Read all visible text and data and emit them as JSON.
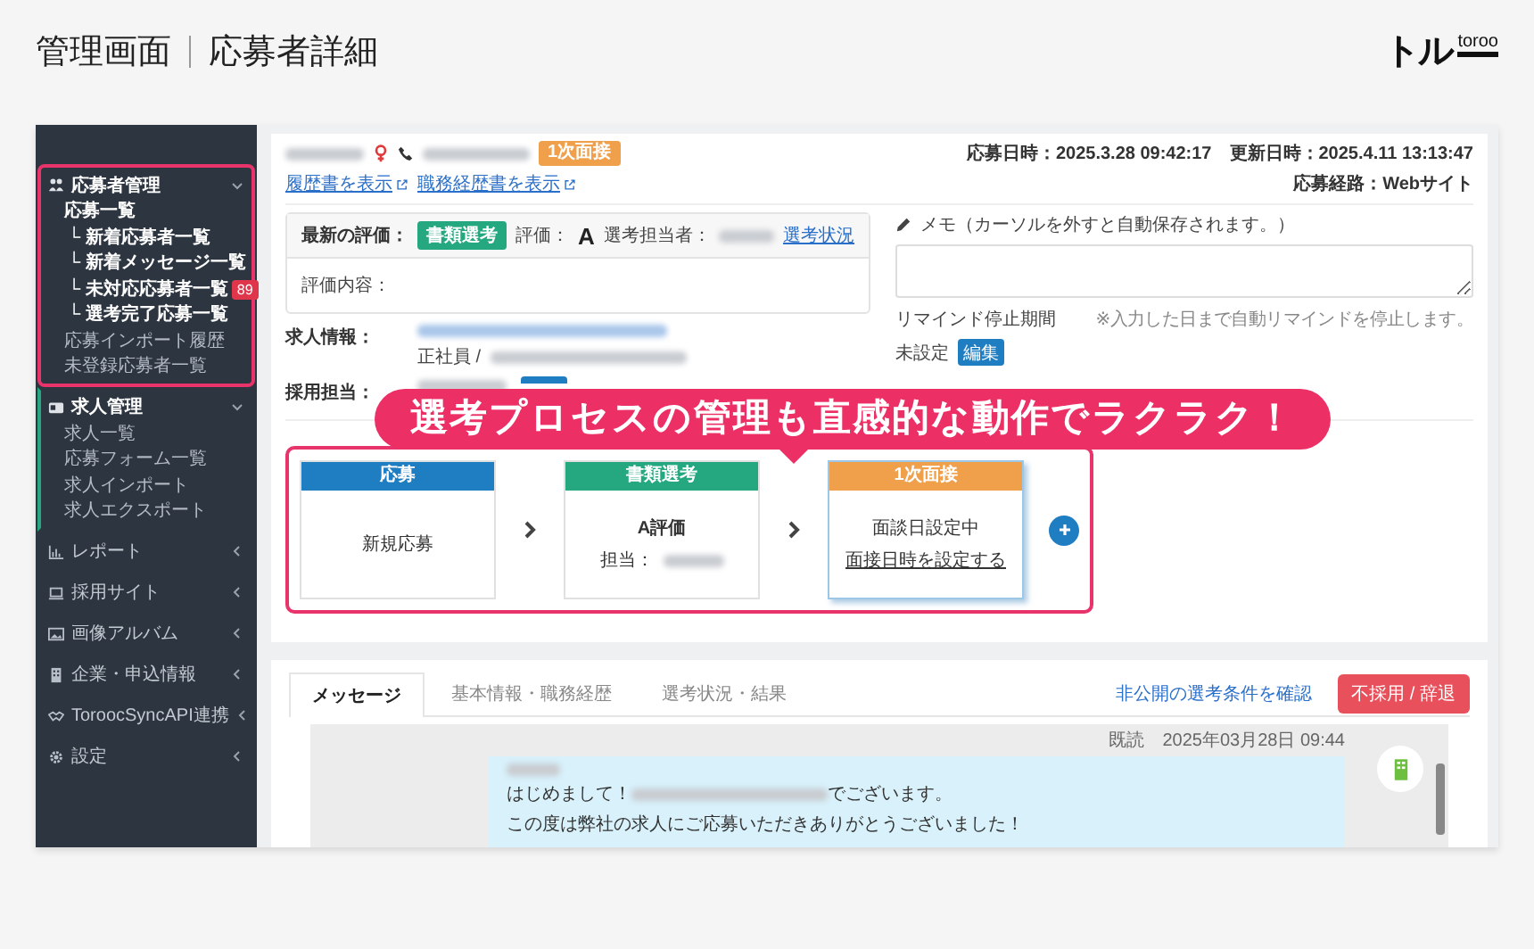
{
  "header": {
    "title": "管理画面",
    "subtitle": "応募者詳細",
    "logo_mark": "トル",
    "logo_text": "toroo"
  },
  "sidebar": {
    "groups": [
      {
        "label": "応募者管理",
        "expanded": true,
        "highlighted": true,
        "items": [
          {
            "label": "応募一覧",
            "current": true,
            "children": [
              {
                "label": "└ 新着応募者一覧",
                "current": true
              },
              {
                "label": "└ 新着メッセージ一覧",
                "current": true
              },
              {
                "label": "└ 未対応応募者一覧",
                "current": true,
                "badge": "89"
              },
              {
                "label": "└ 選考完了応募一覧",
                "current": true
              }
            ]
          },
          {
            "label": "応募インポート履歴",
            "current": false
          },
          {
            "label": "未登録応募者一覧",
            "current": false
          }
        ]
      },
      {
        "label": "求人管理",
        "expanded": true,
        "highlighted": false,
        "items": [
          {
            "label": "求人一覧",
            "current": false
          },
          {
            "label": "応募フォーム一覧",
            "current": false
          },
          {
            "label": "求人インポート",
            "current": false
          },
          {
            "label": "求人エクスポート",
            "current": false
          }
        ]
      },
      {
        "label": "レポート",
        "expanded": false,
        "highlighted": false
      },
      {
        "label": "採用サイト",
        "expanded": false,
        "highlighted": false
      },
      {
        "label": "画像アルバム",
        "expanded": false,
        "highlighted": false
      },
      {
        "label": "企業・申込情報",
        "expanded": false,
        "highlighted": false
      },
      {
        "label": "ToroocSyncAPI連携",
        "expanded": false,
        "highlighted": false
      },
      {
        "label": "設定",
        "expanded": false,
        "highlighted": false
      }
    ]
  },
  "applicant": {
    "status_badge": "1次面接",
    "links": [
      "履歴書を表示",
      "職務経歴書を表示"
    ],
    "applied_at": "応募日時：2025.3.28 09:42:17",
    "updated_at": "更新日時：2025.4.11 13:13:47",
    "source": "応募経路：Webサイト"
  },
  "evaluation": {
    "label": "最新の評価：",
    "stage": "書類選考",
    "rating_label": "評価：",
    "rating": "A",
    "assignee_label": "選考担当者：",
    "status_link": "選考状況",
    "content_label": "評価内容："
  },
  "job": {
    "label": "求人情報：",
    "employment": "正社員 /"
  },
  "recruiter": {
    "label": "採用担当："
  },
  "memo": {
    "label": "メモ（カーソルを外すと自動保存されます。）"
  },
  "remind": {
    "label": "リマインド停止期間",
    "note": "※入力した日まで自動リマインドを停止します。",
    "value": "未設定",
    "edit_button": "編集"
  },
  "callout": "選考プロセスの管理も直感的な動作でラクラク！",
  "process": {
    "highlighted": true,
    "steps": [
      {
        "title": "応募",
        "color": "#1f7dc2",
        "current": false,
        "lines": [
          {
            "kind": "text",
            "text": "新規応募"
          }
        ]
      },
      {
        "title": "書類選考",
        "color": "#25a87f",
        "current": false,
        "lines": [
          {
            "kind": "bold",
            "text": "A評価"
          },
          {
            "kind": "assignee",
            "text": "担当："
          }
        ]
      },
      {
        "title": "1次面接",
        "color": "#f0a04b",
        "current": true,
        "lines": [
          {
            "kind": "text",
            "text": "面談日設定中"
          },
          {
            "kind": "link",
            "text": "面接日時を設定する"
          }
        ]
      }
    ]
  },
  "messages": {
    "tabs": [
      {
        "label": "メッセージ",
        "selected": true
      },
      {
        "label": "基本情報・職務経歴",
        "selected": false
      },
      {
        "label": "選考状況・結果",
        "selected": false
      }
    ],
    "hidden_link": "非公開の選考条件を確認",
    "reject_button": "不採用 / 辞退",
    "thread": [
      {
        "read": "既読",
        "time": "2025年03月28日 09:44",
        "greeting": "はじめまして！",
        "greeting_end": "でございます。",
        "body": "この度は弊社の求人にご応募いただきありがとうございました！"
      }
    ]
  }
}
